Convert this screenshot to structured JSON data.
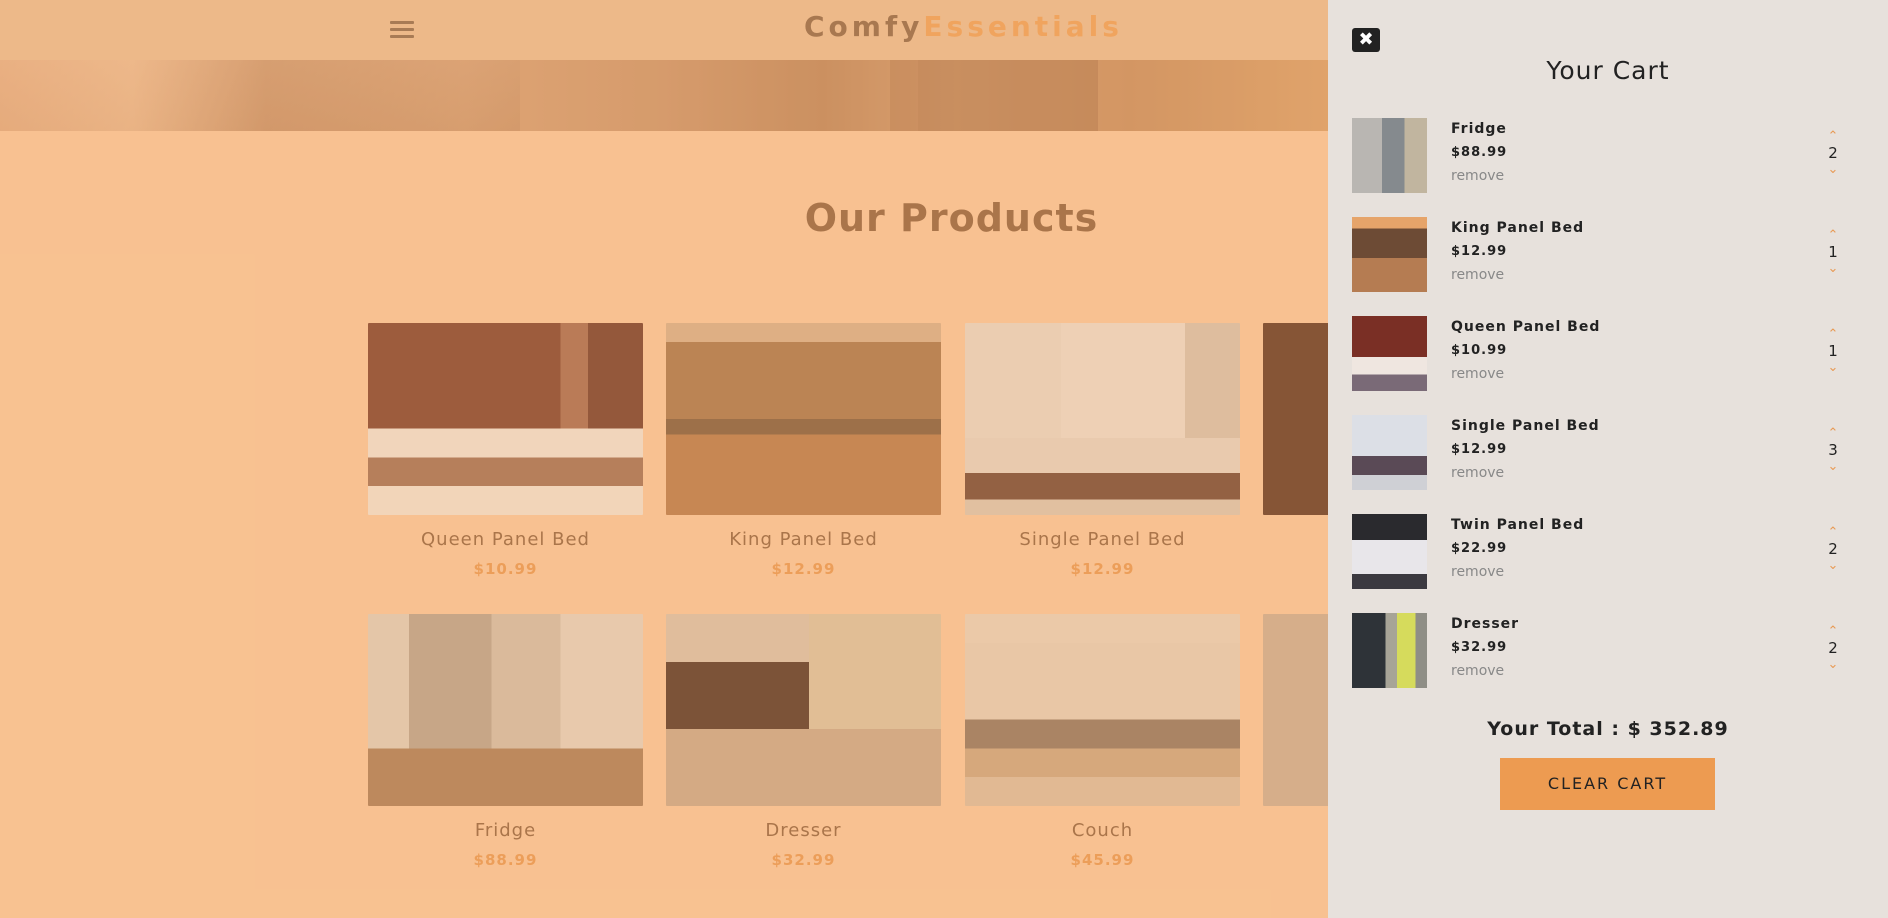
{
  "navbar": {
    "logo_part1": "Comfy",
    "logo_part2": "Essentials",
    "menu_icon": "hamburger-menu-icon"
  },
  "products": {
    "title": "Our Products",
    "items": [
      {
        "name": "Queen Panel Bed",
        "price": "$10.99"
      },
      {
        "name": "King Panel Bed",
        "price": "$12.99"
      },
      {
        "name": "Single Panel Bed",
        "price": "$12.99"
      },
      {
        "name": "",
        "price": ""
      },
      {
        "name": "Fridge",
        "price": "$88.99"
      },
      {
        "name": "Dresser",
        "price": "$32.99"
      },
      {
        "name": "Couch",
        "price": "$45.99"
      },
      {
        "name": "",
        "price": ""
      }
    ]
  },
  "cart": {
    "title": "Your Cart",
    "close_icon": "close-icon",
    "remove_label": "remove",
    "items": [
      {
        "name": "Fridge",
        "price": "$88.99",
        "quantity": "2"
      },
      {
        "name": "King Panel Bed",
        "price": "$12.99",
        "quantity": "1"
      },
      {
        "name": "Queen Panel Bed",
        "price": "$10.99",
        "quantity": "1"
      },
      {
        "name": "Single Panel Bed",
        "price": "$12.99",
        "quantity": "3"
      },
      {
        "name": "Twin Panel Bed",
        "price": "$22.99",
        "quantity": "2"
      },
      {
        "name": "Dresser",
        "price": "$32.99",
        "quantity": "2"
      }
    ],
    "total": "Your Total : $ 352.89",
    "clear_label": "CLEAR CART"
  },
  "colors": {
    "accent": "#ed9b51",
    "brown": "#8c6141",
    "cart_bg": "#e7e1dc",
    "page_bg": "#f8cba3"
  }
}
